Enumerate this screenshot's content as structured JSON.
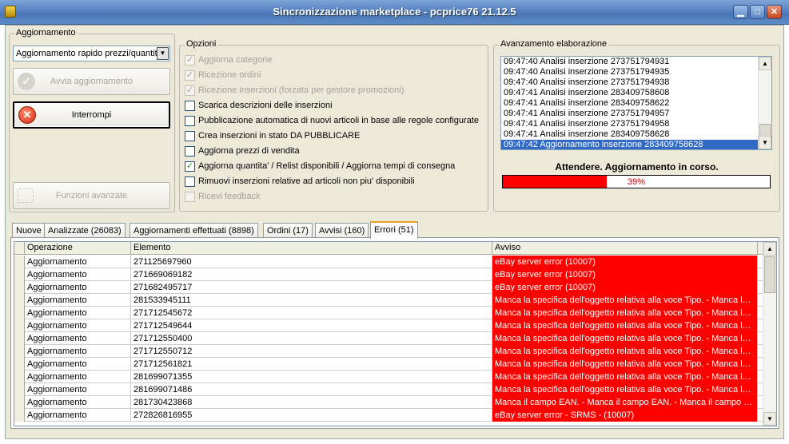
{
  "window": {
    "title": "Sincronizzazione marketplace - pcprice76 21.12.5",
    "minimize_glyph": "▁",
    "maximize_glyph": "□",
    "close_glyph": "✕"
  },
  "aggiornamento": {
    "group_label": "Aggiornamento",
    "mode_selected": "Aggiornamento rapido prezzi/quantit",
    "start_button": "Avvia aggiornamento",
    "stop_button": "Interrompi",
    "advanced_button": "Funzioni avanzate"
  },
  "opzioni": {
    "group_label": "Opzioni",
    "items": [
      {
        "label": "Aggiorna categorie",
        "checked": true,
        "enabled": false
      },
      {
        "label": "Ricezione ordini",
        "checked": true,
        "enabled": false
      },
      {
        "label": "Ricezione inserzioni (forzata per gestore promozioni)",
        "checked": true,
        "enabled": false
      },
      {
        "label": "Scarica descrizioni delle inserzioni",
        "checked": false,
        "enabled": true
      },
      {
        "label": "Pubblicazione automatica di nuovi articoli in base alle regole configurate",
        "checked": false,
        "enabled": true
      },
      {
        "label": "Crea inserzioni in stato DA PUBBLICARE",
        "checked": false,
        "enabled": true
      },
      {
        "label": "Aggiorna prezzi di vendita",
        "checked": false,
        "enabled": true
      },
      {
        "label": "Aggiorna quantita' / Relist disponibili / Aggiorna tempi di consegna",
        "checked": true,
        "enabled": true
      },
      {
        "label": "Rimuovi inserzioni relative ad articoli non piu' disponibili",
        "checked": false,
        "enabled": true
      },
      {
        "label": "Ricevi feedback",
        "checked": false,
        "enabled": false
      }
    ]
  },
  "avanzamento": {
    "group_label": "Avanzamento elaborazione",
    "log": [
      "09:47:40 Analisi inserzione 273751794931",
      "09:47:40 Analisi inserzione 273751794935",
      "09:47:40 Analisi inserzione 273751794938",
      "09:47:41 Analisi inserzione 283409758608",
      "09:47:41 Analisi inserzione 283409758622",
      "09:47:41 Analisi inserzione 273751794957",
      "09:47:41 Analisi inserzione 273751794958",
      "09:47:41 Analisi inserzione 283409758628",
      "09:47:42 Aggiornamento inserzione 283409758628"
    ],
    "status": "Attendere. Aggiornamento in corso.",
    "progress_fraction": 0.39,
    "progress_label": "39%"
  },
  "tabs": [
    {
      "label": "Nuove"
    },
    {
      "label": "Analizzate (26083)"
    },
    {
      "label": "Aggiornamenti effettuati (8898)"
    },
    {
      "label": "Ordini (17)"
    },
    {
      "label": "Avvisi (160)"
    },
    {
      "label": "Errori (51)"
    }
  ],
  "grid": {
    "columns": [
      "Operazione",
      "Elemento",
      "Avviso"
    ],
    "rows": [
      [
        "Aggiornamento",
        "271125697960",
        "eBay server error (10007)"
      ],
      [
        "Aggiornamento",
        "271669069182",
        "eBay server error (10007)"
      ],
      [
        "Aggiornamento",
        "271682495717",
        "eBay server error (10007)"
      ],
      [
        "Aggiornamento",
        "281533945111",
        "Manca la specifica dell'oggetto relativa alla voce Tipo. - Manca la ..."
      ],
      [
        "Aggiornamento",
        "271712545672",
        "Manca la specifica dell'oggetto relativa alla voce Tipo. - Manca la ..."
      ],
      [
        "Aggiornamento",
        "271712549644",
        "Manca la specifica dell'oggetto relativa alla voce Tipo. - Manca la ..."
      ],
      [
        "Aggiornamento",
        "271712550400",
        "Manca la specifica dell'oggetto relativa alla voce Tipo. - Manca la ..."
      ],
      [
        "Aggiornamento",
        "271712550712",
        "Manca la specifica dell'oggetto relativa alla voce Tipo. - Manca la ..."
      ],
      [
        "Aggiornamento",
        "271712561821",
        "Manca la specifica dell'oggetto relativa alla voce Tipo. - Manca la ..."
      ],
      [
        "Aggiornamento",
        "281699071355",
        "Manca la specifica dell'oggetto relativa alla voce Tipo. - Manca la ..."
      ],
      [
        "Aggiornamento",
        "281699071486",
        "Manca la specifica dell'oggetto relativa alla voce Tipo. - Manca la ..."
      ],
      [
        "Aggiornamento",
        "281730423868",
        "Manca il campo EAN. - Manca il campo EAN. - Manca il campo EAN..."
      ],
      [
        "Aggiornamento",
        "272826816955",
        "eBay server error - SRMS -  (10007)"
      ]
    ]
  }
}
